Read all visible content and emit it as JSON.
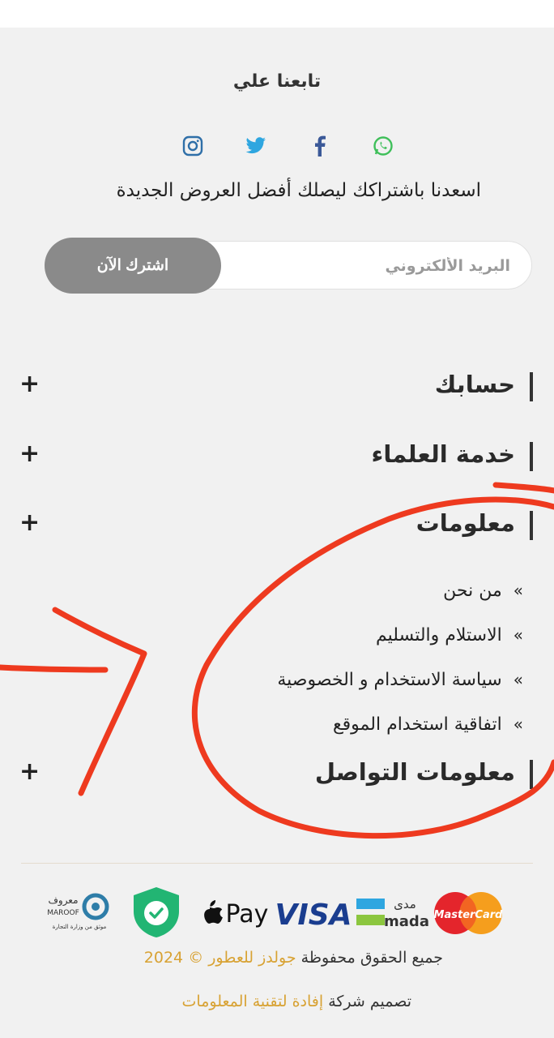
{
  "follow": {
    "title": "تابعنا علي"
  },
  "social": {
    "icons": [
      "whatsapp-icon",
      "facebook-icon",
      "twitter-icon",
      "instagram-icon"
    ],
    "colors": {
      "whatsapp": "#3fbf5a",
      "facebook": "#3b5998",
      "twitter": "#2ea6e0",
      "instagram": "#2f6fa8"
    }
  },
  "newsletter": {
    "text": "اسعدنا باشتراكك ليصلك أفضل العروض الجديدة",
    "placeholder": "البريد الألكتروني",
    "button": "اشترك الآن"
  },
  "sections": [
    {
      "label": "حسابك",
      "toggle": "+"
    },
    {
      "label": "خدمة العلماء",
      "toggle": "+"
    },
    {
      "label": "معلومات",
      "toggle": "+"
    },
    {
      "label": "معلومات التواصل",
      "toggle": "+"
    }
  ],
  "info_links": {
    "arrow": "»",
    "items": [
      "من نحن",
      "الاستلام والتسليم",
      "سياسة الاستخدام و الخصوصية",
      "اتفاقية استخدام الموقع"
    ]
  },
  "payments": {
    "mastercard": "MasterCard",
    "mada_ar": "مدى",
    "mada_en": "mada",
    "visa": "VISA",
    "applepay": "Pay",
    "maroof_ar": "معروف",
    "maroof_en": "MAROOF",
    "maroof_sub": "موثق من وزارة التجارة"
  },
  "footer": {
    "rights": "جميع الحقوق محفوظة",
    "store": "جولدز للعطور",
    "year": "© 2024",
    "design_prefix": "تصميم شركة",
    "company": "إفادة لتقنية المعلومات"
  },
  "colors": {
    "accent": "#d8a233",
    "annotation": "#ee3a1f",
    "button": "#8a8a8a"
  }
}
